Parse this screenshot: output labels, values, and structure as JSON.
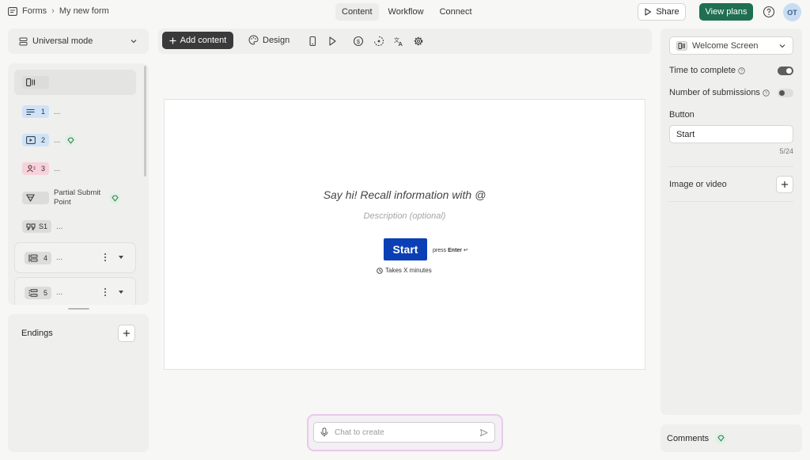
{
  "breadcrumb": {
    "root": "Forms",
    "current": "My new form"
  },
  "tabs": [
    {
      "label": "Content",
      "active": true
    },
    {
      "label": "Workflow",
      "active": false
    },
    {
      "label": "Connect",
      "active": false
    }
  ],
  "header": {
    "share_label": "Share",
    "view_plans_label": "View plans",
    "avatar_initials": "OT"
  },
  "mode": {
    "label": "Universal mode"
  },
  "questions": [
    {
      "type": "welcome",
      "number": "",
      "text": "",
      "selected": true
    },
    {
      "type": "text",
      "number": "1",
      "text": "..."
    },
    {
      "type": "video",
      "number": "2",
      "text": "...",
      "premium": true
    },
    {
      "type": "contact",
      "number": "3",
      "text": "..."
    },
    {
      "type": "partial-submit",
      "number": "",
      "text": "Partial Submit Point",
      "premium": true
    },
    {
      "type": "statement",
      "number": "S1",
      "text": "..."
    },
    {
      "type": "group",
      "number": "4",
      "text": "..."
    },
    {
      "type": "group",
      "number": "5",
      "text": "..."
    }
  ],
  "endings": {
    "label": "Endings"
  },
  "toolbar": {
    "add_content_label": "Add content",
    "design_label": "Design"
  },
  "form": {
    "title": "Say hi! Recall information with @",
    "description_placeholder": "Description (optional)",
    "start_label": "Start",
    "press_label": "press",
    "enter_label": "Enter",
    "enter_symbol": "↵",
    "takes_label": "Takes X minutes"
  },
  "chat": {
    "placeholder": "Chat to create"
  },
  "settings": {
    "screen_label": "Welcome Screen",
    "time_to_complete_label": "Time to complete",
    "time_to_complete_on": true,
    "submissions_label": "Number of submissions",
    "submissions_on": false,
    "button_section_label": "Button",
    "button_value": "Start",
    "button_counter": "5/24",
    "image_label": "Image or video"
  },
  "comments": {
    "label": "Comments"
  },
  "colors": {
    "accent_green": "#1f6f52",
    "start_blue": "#0b3fb5"
  }
}
